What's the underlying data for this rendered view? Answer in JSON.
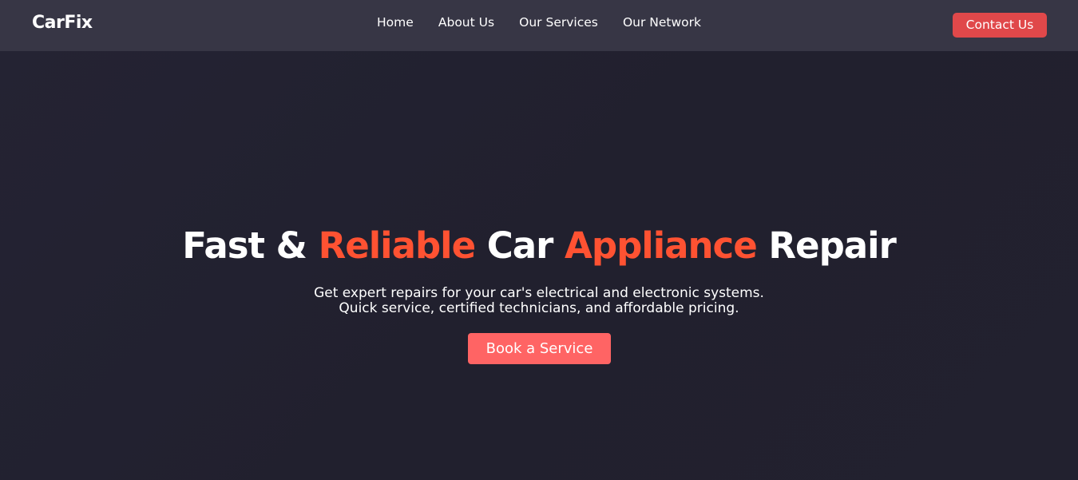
{
  "brand": {
    "name": "CarFix"
  },
  "nav": {
    "links": [
      "Home",
      "About Us",
      "Our Services",
      "Our Network"
    ],
    "contact_label": "Contact Us"
  },
  "hero": {
    "title_parts": [
      "Fast & ",
      "Reliable",
      " Car ",
      "Appliance",
      " Repair"
    ],
    "subtitle_line1": "Get expert repairs for your car's electrical and electronic systems.",
    "subtitle_line2": "Quick service, certified technicians, and affordable pricing.",
    "cta_label": "Book a Service"
  },
  "colors": {
    "navbar_bg": "#373645",
    "page_bg": "#22212f",
    "accent": "#ff5232",
    "contact_button": "#e0484a",
    "cta_button": "#ff6464"
  }
}
